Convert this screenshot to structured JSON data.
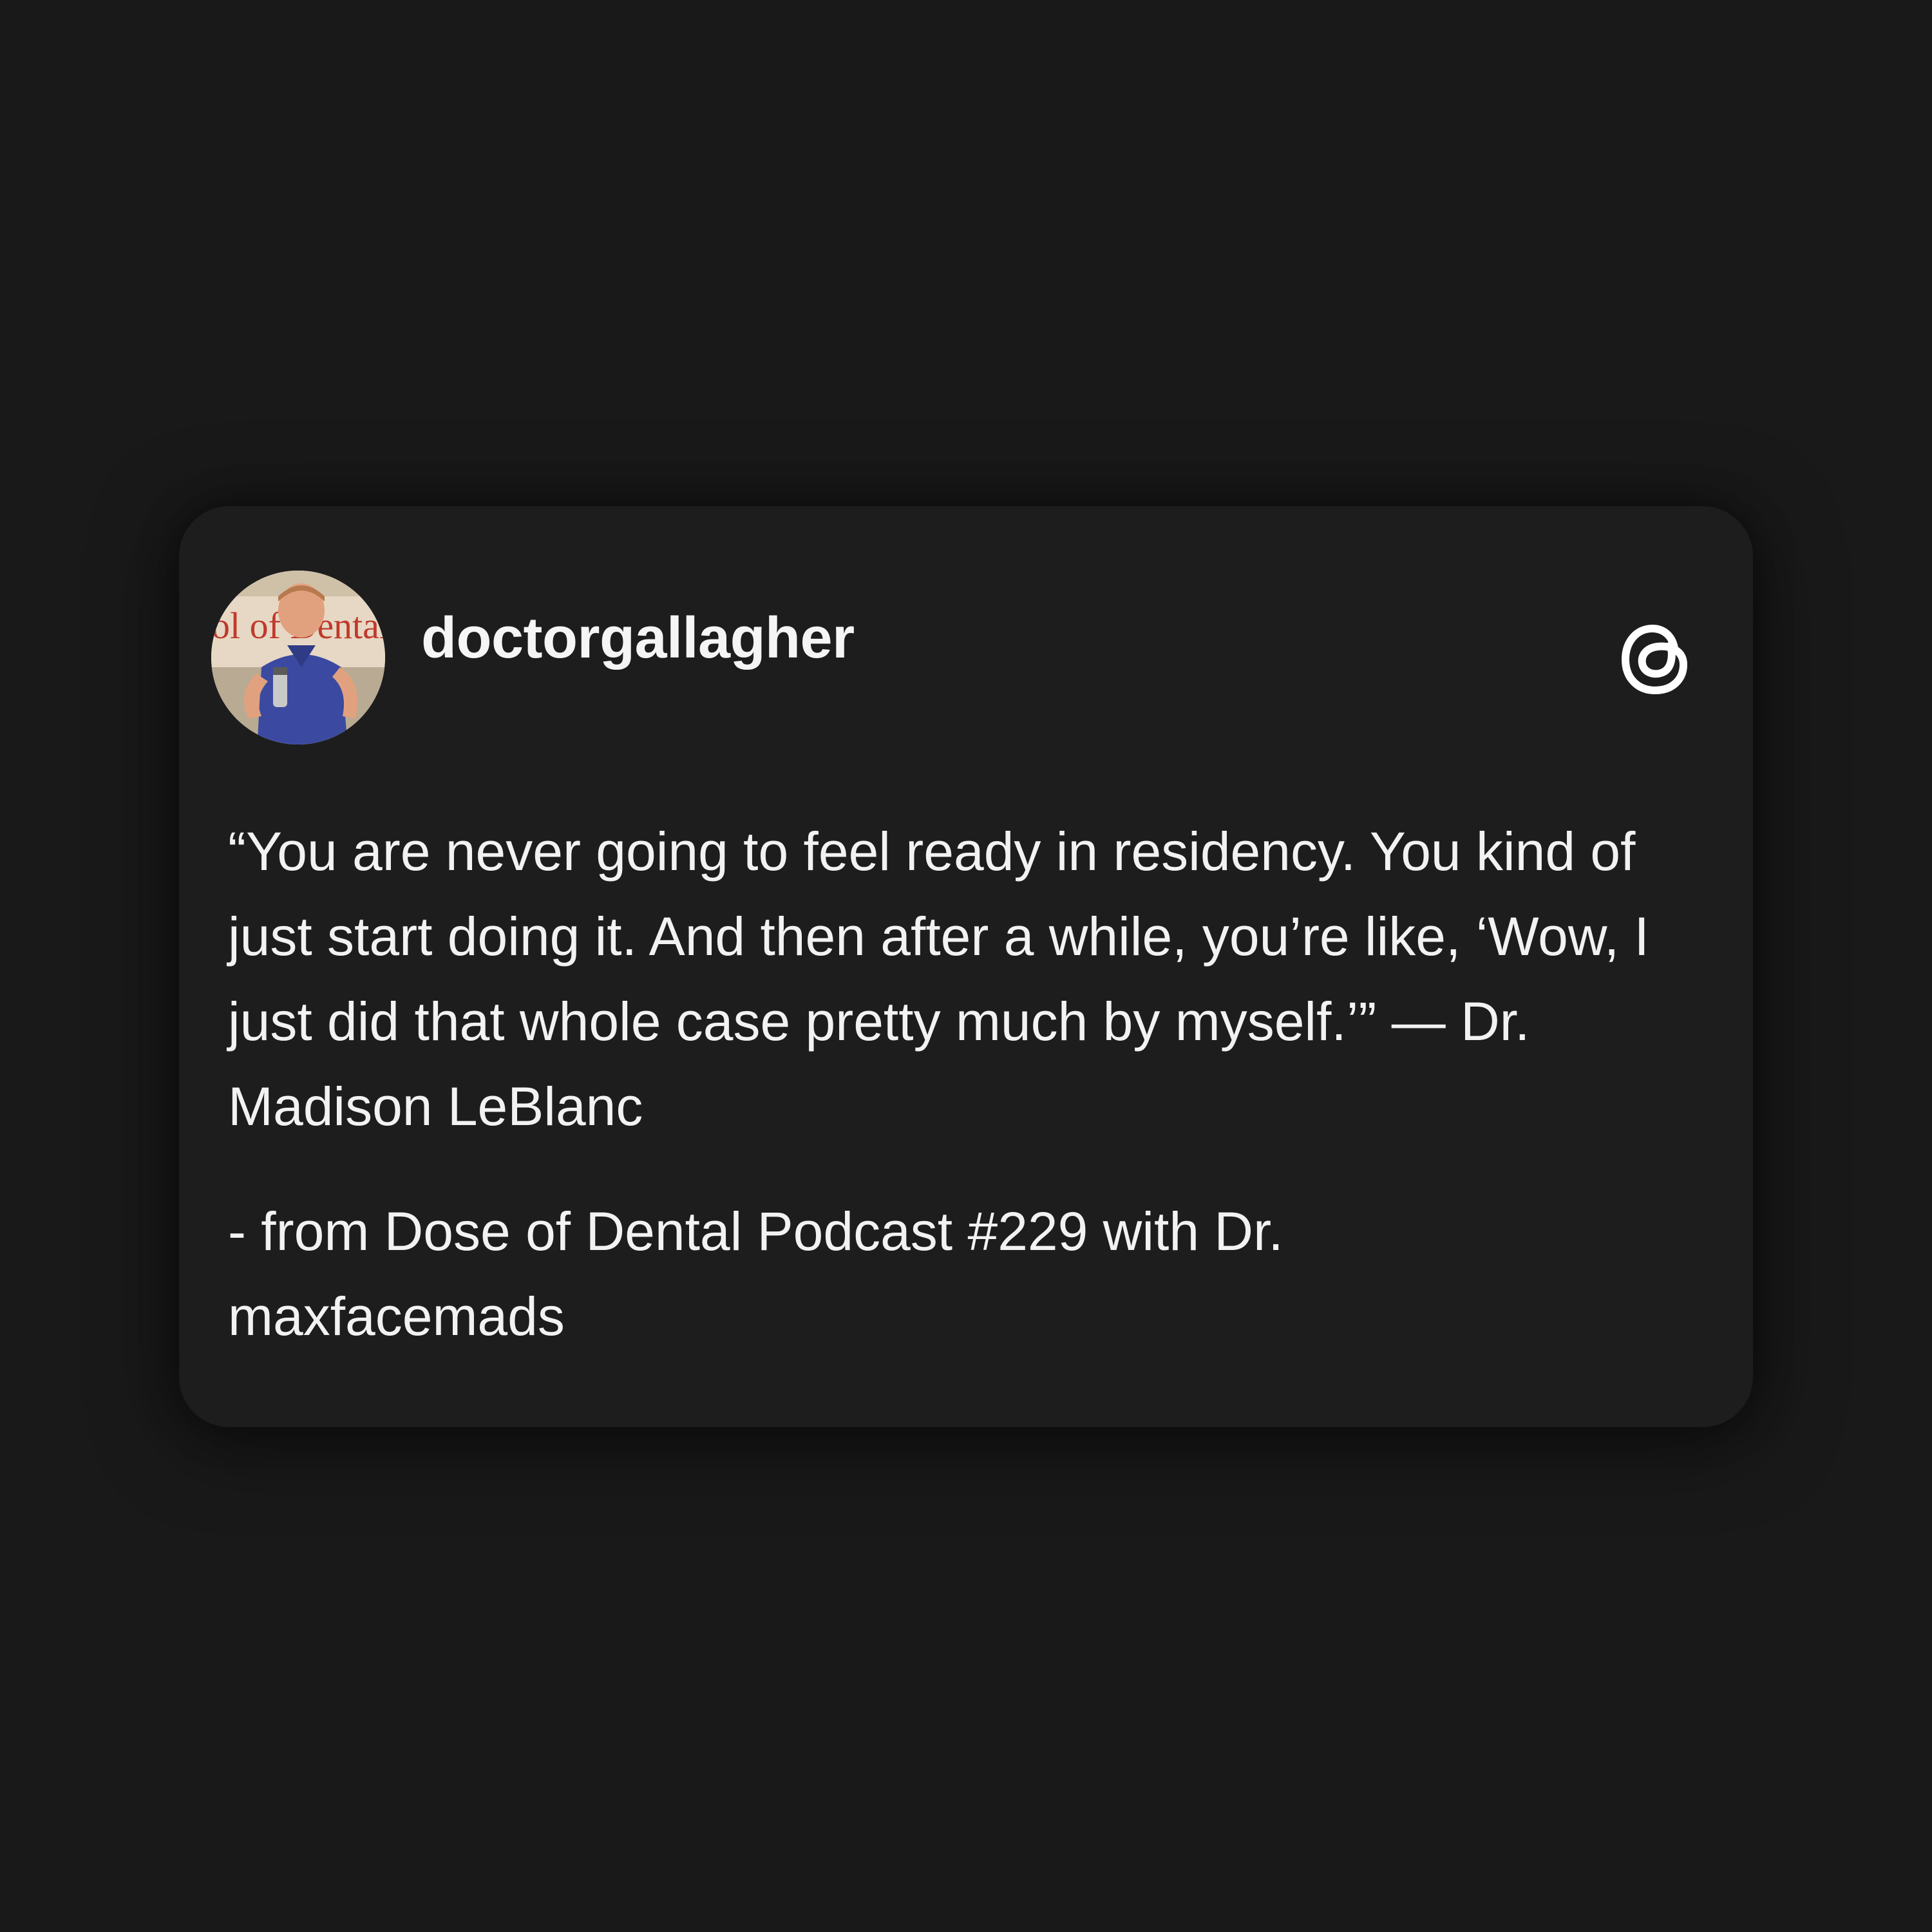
{
  "post": {
    "username": "doctorgallagher",
    "avatar_icon": "profile-photo",
    "platform_icon": "threads-logo-icon",
    "quote_text": "“You are never going to feel ready in residency. You kind of just start doing it. And then after a while, you’re like, ‘Wow, I just did that whole case pretty much by myself.’” — Dr. Madison LeBlanc",
    "source_text": "- from Dose of Dental Podcast #229 with Dr. maxfacemads"
  },
  "avatar": {
    "banner_text": "ol of Dental"
  },
  "colors": {
    "background": "#191919",
    "card": "#1d1d1d",
    "text": "#f2f2f2"
  }
}
